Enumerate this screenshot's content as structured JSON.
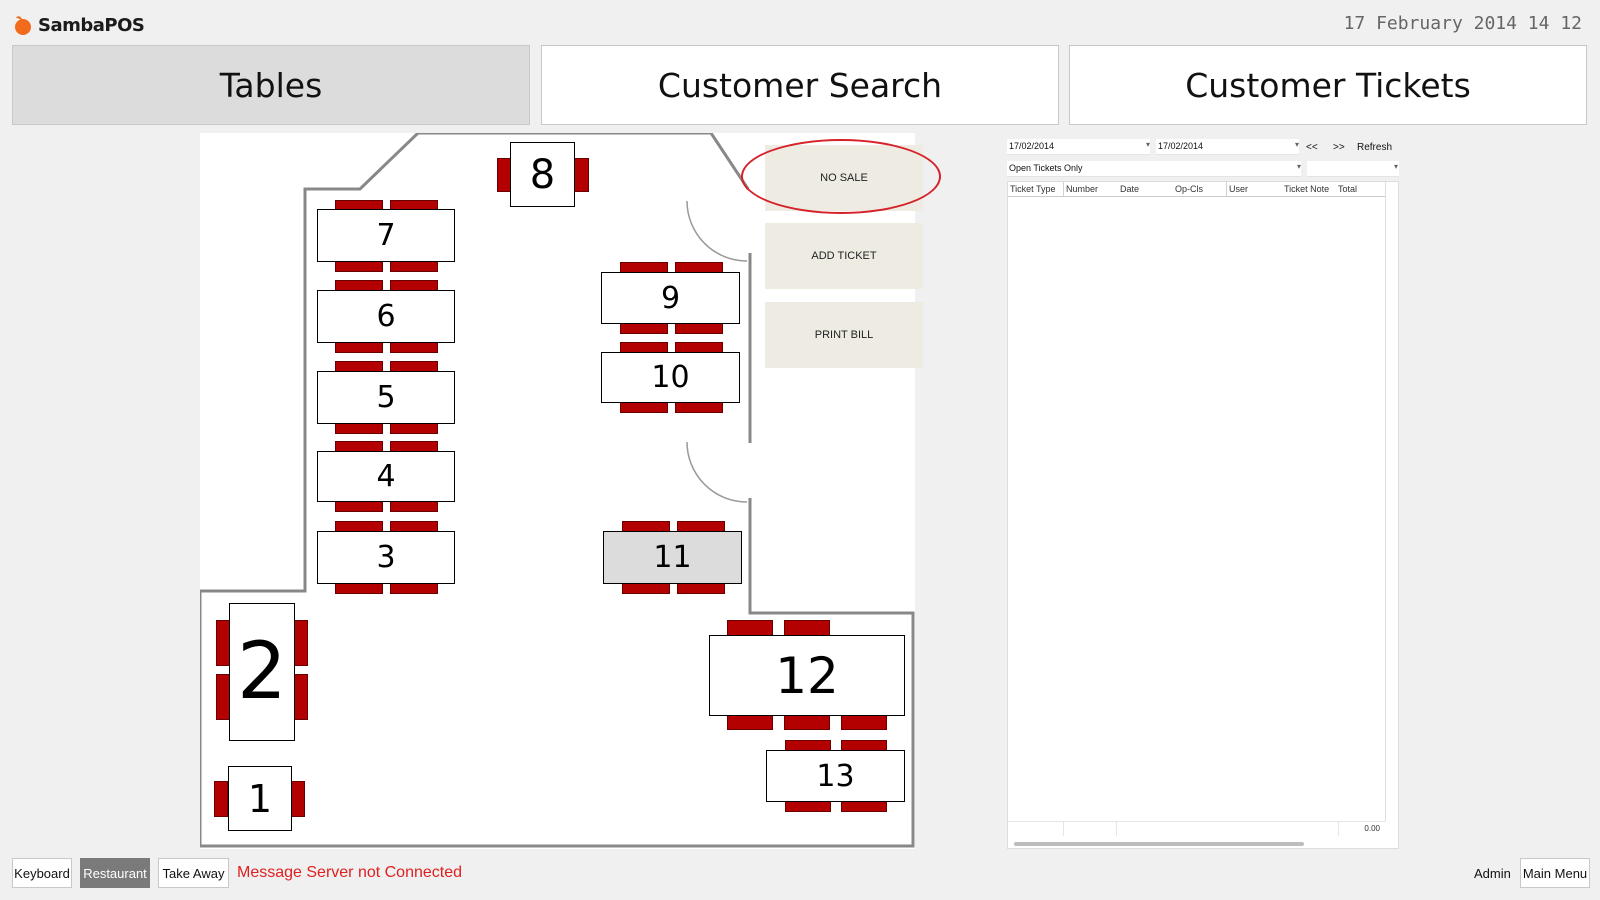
{
  "header": {
    "app_name": "SambaPOS",
    "datetime": "17 February 2014 14 12"
  },
  "nav": {
    "tables": "Tables",
    "customer_search": "Customer Search",
    "customer_tickets": "Customer Tickets",
    "active": "Tables"
  },
  "tables": [
    {
      "id": "1",
      "label": "1"
    },
    {
      "id": "2",
      "label": "2"
    },
    {
      "id": "3",
      "label": "3"
    },
    {
      "id": "4",
      "label": "4"
    },
    {
      "id": "5",
      "label": "5"
    },
    {
      "id": "6",
      "label": "6"
    },
    {
      "id": "7",
      "label": "7"
    },
    {
      "id": "8",
      "label": "8"
    },
    {
      "id": "9",
      "label": "9"
    },
    {
      "id": "10",
      "label": "10"
    },
    {
      "id": "11",
      "label": "11"
    },
    {
      "id": "12",
      "label": "12"
    },
    {
      "id": "13",
      "label": "13"
    }
  ],
  "actions": {
    "no_sale": "NO SALE",
    "add_ticket": "ADD TICKET",
    "print_bill": "PRINT BILL"
  },
  "ticket_panel": {
    "date_from": "17/02/2014",
    "date_to": "17/02/2014",
    "prev": "<<",
    "next": ">>",
    "refresh": "Refresh",
    "filter": "Open Tickets Only",
    "columns": [
      "Ticket Type",
      "Number",
      "Date",
      "Op-Cls",
      "User",
      "Ticket Note",
      "Total"
    ],
    "total": "0.00"
  },
  "footer": {
    "keyboard": "Keyboard",
    "restaurant": "Restaurant",
    "take_away": "Take Away",
    "message": "Message Server not Connected",
    "user": "Admin",
    "main_menu": "Main Menu"
  },
  "colors": {
    "chair": "#b30000",
    "highlight_ellipse": "#d62128",
    "message_text": "#e02020"
  }
}
